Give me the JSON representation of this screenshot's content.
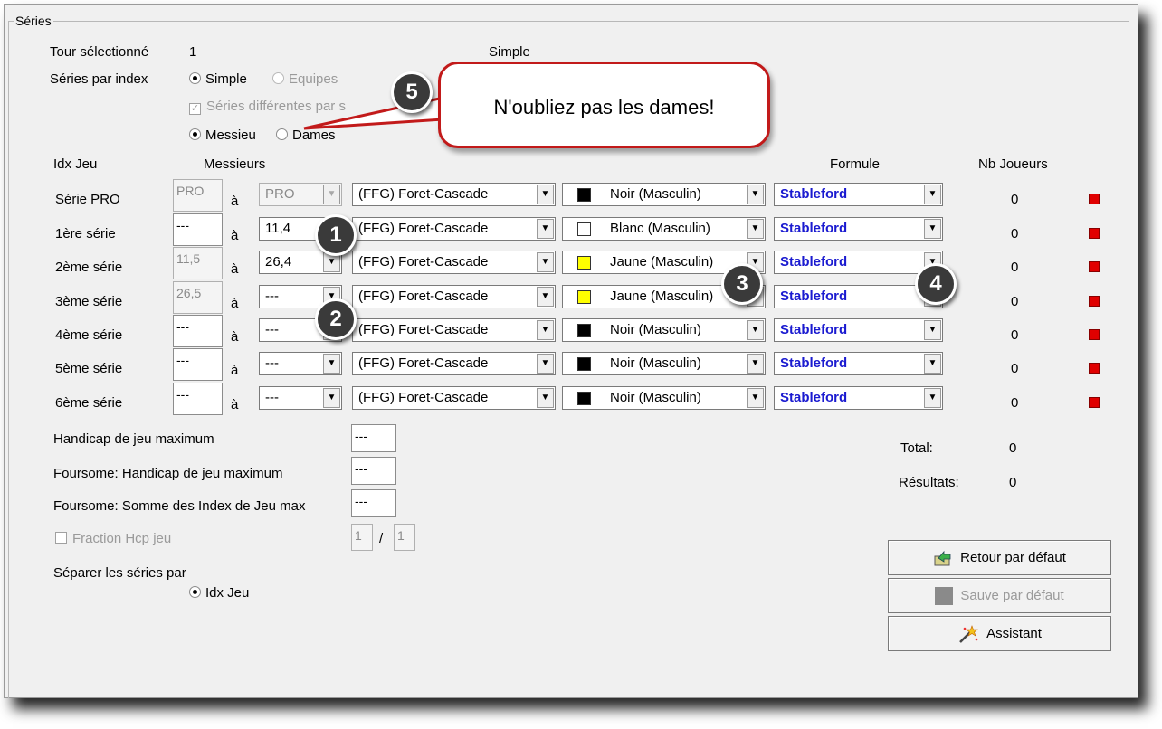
{
  "group_title": "Séries",
  "tour": {
    "label": "Tour sélectionné",
    "value": "1",
    "mode": "Simple"
  },
  "series_par_index": {
    "label": "Séries par index",
    "opt_simple": "Simple",
    "opt_equipes": "Equipes",
    "different_label": "Séries différentes par s",
    "opt_messieurs": "Messieu",
    "opt_dames": "Dames"
  },
  "headers": {
    "idx": "Idx Jeu",
    "messieurs": "Messieurs",
    "formule": "Formule",
    "nb": "Nb Joueurs"
  },
  "a_label": "à",
  "rows": [
    {
      "name": "Série PRO",
      "from": "PRO",
      "to": "PRO",
      "course": "(FFG) Foret-Cascade",
      "tee": "Noir (Masculin)",
      "tee_color": "#000000",
      "formula": "Stableford",
      "count": "0"
    },
    {
      "name": "1ère série",
      "from": "---",
      "to": "11,4",
      "course": "(FFG) Foret-Cascade",
      "tee": "Blanc (Masculin)",
      "tee_color": "#ffffff",
      "formula": "Stableford",
      "count": "0"
    },
    {
      "name": "2ème série",
      "from": "11,5",
      "to": "26,4",
      "course": "(FFG) Foret-Cascade",
      "tee": "Jaune (Masculin)",
      "tee_color": "#ffff00",
      "formula": "Stableford",
      "count": "0"
    },
    {
      "name": "3ème série",
      "from": "26,5",
      "to": "---",
      "course": "(FFG) Foret-Cascade",
      "tee": "Jaune (Masculin)",
      "tee_color": "#ffff00",
      "formula": "Stableford",
      "count": "0"
    },
    {
      "name": "4ème série",
      "from": "---",
      "to": "---",
      "course": "(FFG) Foret-Cascade",
      "tee": "Noir (Masculin)",
      "tee_color": "#000000",
      "formula": "Stableford",
      "count": "0"
    },
    {
      "name": "5ème série",
      "from": "---",
      "to": "---",
      "course": "(FFG) Foret-Cascade",
      "tee": "Noir (Masculin)",
      "tee_color": "#000000",
      "formula": "Stableford",
      "count": "0"
    },
    {
      "name": "6ème série",
      "from": "---",
      "to": "---",
      "course": "(FFG) Foret-Cascade",
      "tee": "Noir (Masculin)",
      "tee_color": "#000000",
      "formula": "Stableford",
      "count": "0"
    }
  ],
  "handicap_max": {
    "label": "Handicap de jeu maximum",
    "value": "---"
  },
  "foursome_handicap": {
    "label": "Foursome: Handicap de jeu maximum",
    "value": "---"
  },
  "foursome_somme": {
    "label": "Foursome: Somme des Index de Jeu max",
    "value": "---"
  },
  "fraction": {
    "label": "Fraction Hcp jeu",
    "num": "1",
    "sep": "/",
    "den": "1"
  },
  "separer": {
    "label": "Séparer les séries par",
    "option": "Idx Jeu"
  },
  "total": {
    "label": "Total:",
    "value": "0"
  },
  "resultats": {
    "label": "Résultats:",
    "value": "0"
  },
  "buttons": {
    "retour": "Retour par défaut",
    "sauve": "Sauve par défaut",
    "assistant": "Assistant"
  },
  "callout": {
    "text": "N'oubliez pas les dames!"
  },
  "badges": [
    "1",
    "2",
    "3",
    "4",
    "5"
  ]
}
